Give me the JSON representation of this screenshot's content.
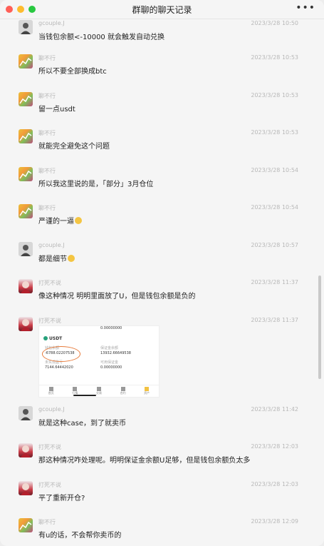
{
  "window": {
    "title": "群聊的聊天记录",
    "more_label": "•••"
  },
  "messages": [
    {
      "author": "gcouple.J",
      "time": "2023/3/28 10:50",
      "avatar": "portrait",
      "text": "当钱包余额<-10000 就会触发自动兑换"
    },
    {
      "author": "聊不行",
      "time": "2023/3/28 10:53",
      "avatar": "chart",
      "text": "所以不要全部换成btc"
    },
    {
      "author": "聊不行",
      "time": "2023/3/28 10:53",
      "avatar": "chart",
      "text": "留一点usdt"
    },
    {
      "author": "聊不行",
      "time": "2023/3/28 10:53",
      "avatar": "chart",
      "text": "就能完全避免这个问题"
    },
    {
      "author": "聊不行",
      "time": "2023/3/28 10:54",
      "avatar": "chart",
      "text": "所以我这里说的是，「部分」3月仓位"
    },
    {
      "author": "聊不行",
      "time": "2023/3/28 10:54",
      "avatar": "chart",
      "text": "严谨的一逼",
      "emoji": "smile"
    },
    {
      "author": "gcouple.J",
      "time": "2023/3/28 10:57",
      "avatar": "portrait",
      "text": "都是细节",
      "emoji": "smile"
    },
    {
      "author": "打死不说",
      "time": "2023/3/28 11:37",
      "avatar": "anime",
      "text": "像这种情况 明明里面放了U，但是钱包余额是负的"
    },
    {
      "author": "打死不说",
      "time": "2023/3/28 11:37",
      "avatar": "anime",
      "image": {
        "top_value": "0.00000000",
        "asset": "USDT",
        "wallet_label": "钱包余额",
        "wallet_value": "-6788.02207538",
        "margin_label": "保证金余额",
        "margin_value": "13932.66649538",
        "unrealized_label": "未实现盈亏",
        "unrealized_value": "7144.64442020",
        "available_label": "可用保证金",
        "available_value": "0.00000000",
        "tabs": [
          "首页",
          "行情",
          "交易",
          "合约",
          "资产"
        ]
      }
    },
    {
      "author": "gcouple.J",
      "time": "2023/3/28 11:42",
      "avatar": "portrait",
      "text": "就是这种case，到了就卖币"
    },
    {
      "author": "打死不说",
      "time": "2023/3/28 12:03",
      "avatar": "anime",
      "text": "那这种情况咋处理呢。明明保证金余额U足够，但是钱包余额负太多"
    },
    {
      "author": "打死不说",
      "time": "2023/3/28 12:03",
      "avatar": "anime",
      "text": "平了重新开仓?"
    },
    {
      "author": "聊不行",
      "time": "2023/3/28 12:09",
      "avatar": "chart",
      "text": "有u的话，不会帮你卖币的"
    }
  ]
}
